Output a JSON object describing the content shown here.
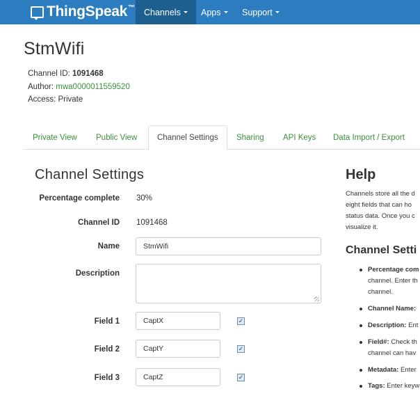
{
  "navbar": {
    "brand": "ThingSpeak",
    "brand_tm": "™",
    "items": [
      {
        "label": "Channels"
      },
      {
        "label": "Apps"
      },
      {
        "label": "Support"
      }
    ]
  },
  "channel": {
    "title": "StmWifi",
    "id_label": "Channel ID:",
    "id_value": "1091468",
    "author_label": "Author:",
    "author_value": "mwa0000011559520",
    "access_label": "Access:",
    "access_value": "Private"
  },
  "tabs": [
    {
      "label": "Private View"
    },
    {
      "label": "Public View"
    },
    {
      "label": "Channel Settings"
    },
    {
      "label": "Sharing"
    },
    {
      "label": "API Keys"
    },
    {
      "label": "Data Import / Export"
    }
  ],
  "settings": {
    "title": "Channel Settings",
    "percentage_label": "Percentage complete",
    "percentage_value": "30%",
    "channel_id_label": "Channel ID",
    "channel_id_value": "1091468",
    "name_label": "Name",
    "name_value": "StmWifi",
    "description_label": "Description",
    "description_value": "",
    "fields": [
      {
        "label": "Field 1",
        "value": "CaptX",
        "checked": true
      },
      {
        "label": "Field 2",
        "value": "CaptY",
        "checked": true
      },
      {
        "label": "Field 3",
        "value": "CaptZ",
        "checked": true
      }
    ],
    "check_mark": "✓"
  },
  "help": {
    "title": "Help",
    "text": "Channels store all the d\neight fields that can ho\nstatus data. Once you c\nvisualize it.",
    "subtitle": "Channel Setti",
    "items": [
      {
        "term": "Percentage com",
        "rest": "",
        "cont": "channel. Enter th\nchannel."
      },
      {
        "term": "Channel Name:",
        "rest": "",
        "cont": ""
      },
      {
        "term": "Description:",
        "rest": " Ent",
        "cont": ""
      },
      {
        "term": "Field#:",
        "rest": " Check th",
        "cont": "channel can hav"
      },
      {
        "term": "Metadata:",
        "rest": " Enter",
        "cont": ""
      },
      {
        "term": "Tags:",
        "rest": " Enter keyw",
        "cont": ""
      }
    ]
  }
}
